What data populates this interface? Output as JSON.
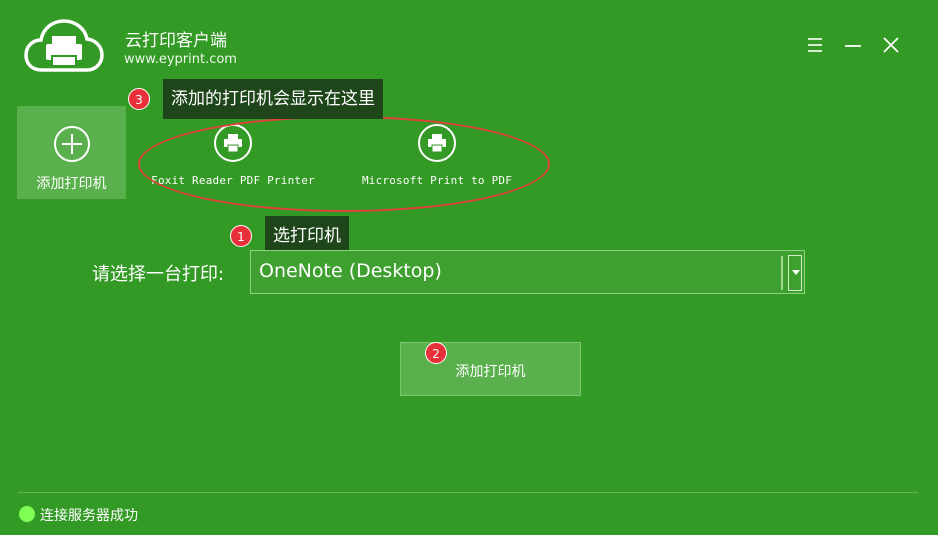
{
  "app": {
    "title": "云打印客户端",
    "url": "www.eyprint.com",
    "icons": [
      "cloud-printer-logo",
      "menu-icon",
      "minimize-icon",
      "close-icon"
    ]
  },
  "printers": {
    "add_tile_label": "添加打印机",
    "items": [
      {
        "name": "Foxit Reader PDF Printer",
        "icon": "printer-icon"
      },
      {
        "name": "Microsoft Print to PDF",
        "icon": "printer-icon"
      }
    ]
  },
  "callouts": [
    {
      "number": "3",
      "text": "添加的打印机会显示在这里"
    },
    {
      "number": "1",
      "text": "选打印机"
    },
    {
      "number": "2",
      "text": ""
    }
  ],
  "form": {
    "select_label": "请选择一台打印:",
    "selected_printer": "OneNote (Desktop)",
    "add_button_label": "添加打印机"
  },
  "status": {
    "text": "连接服务器成功",
    "color": "#7fff53"
  },
  "colors": {
    "background": "#339a25",
    "tile": "#5bb04e",
    "callout_badge": "#e8303a",
    "tooltip_bg": "#1e461a",
    "highlight_ellipse": "#e0443a"
  }
}
